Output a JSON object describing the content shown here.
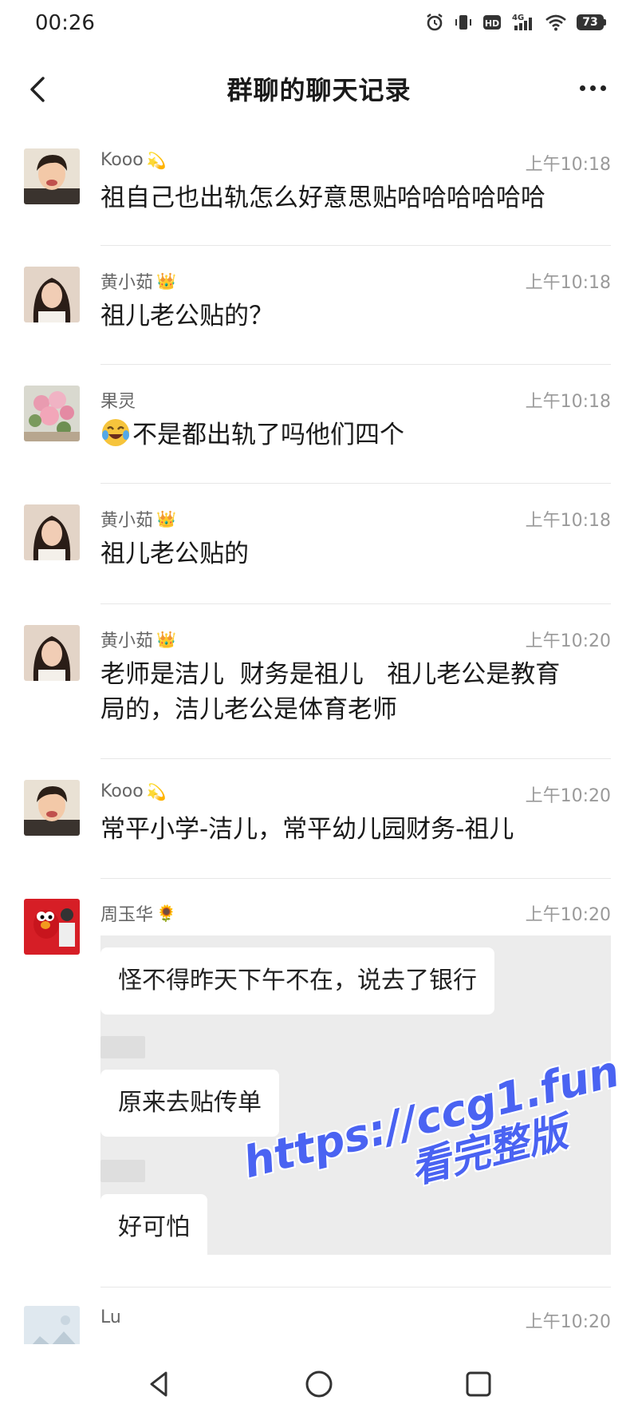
{
  "status_bar": {
    "time": "00:26",
    "battery": "73",
    "network": "4G",
    "hd_label": "HD"
  },
  "header": {
    "title": "群聊的聊天记录",
    "back_icon": "chevron-left-icon",
    "more_icon": "more-dots-icon"
  },
  "messages": [
    {
      "sender": "Kooo",
      "badge": "💫",
      "time": "上午10:18",
      "text": "祖自己也出轨怎么好意思贴哈哈哈哈哈哈"
    },
    {
      "sender": "黄小茹",
      "badge": "👑",
      "time": "上午10:18",
      "text": "祖儿老公贴的？"
    },
    {
      "sender": "果灵",
      "badge": "",
      "time": "上午10:18",
      "emoji": "😭",
      "text": "不是都出轨了吗他们四个"
    },
    {
      "sender": "黄小茹",
      "badge": "👑",
      "time": "上午10:18",
      "text": "祖儿老公贴的"
    },
    {
      "sender": "黄小茹",
      "badge": "👑",
      "time": "上午10:20",
      "text_line1": "老师是洁儿  财务是祖儿   祖儿老公是教育",
      "text_line2": "局的，洁儿老公是体育老师"
    },
    {
      "sender": "Kooo",
      "badge": "💫",
      "time": "上午10:20",
      "text": "常平小学-洁儿，常平幼儿园财务-祖儿"
    },
    {
      "sender": "周玉华",
      "badge": "🌻",
      "time": "上午10:20",
      "bubbles": [
        "怪不得昨天下午不在，说去了银行",
        "原来去贴传单",
        "好可怕"
      ]
    },
    {
      "sender": "Lu",
      "badge": "",
      "time": "上午10:20"
    }
  ],
  "watermark": {
    "url": "https://ccg1.fun",
    "cta": "看完整版"
  },
  "nav": {
    "back_icon": "triangle-back-icon",
    "home_icon": "circle-home-icon",
    "recents_icon": "square-recents-icon"
  },
  "colors": {
    "watermark": "#4a63f2",
    "timestamp": "#9a9a9a",
    "divider": "#e7e7e7"
  }
}
